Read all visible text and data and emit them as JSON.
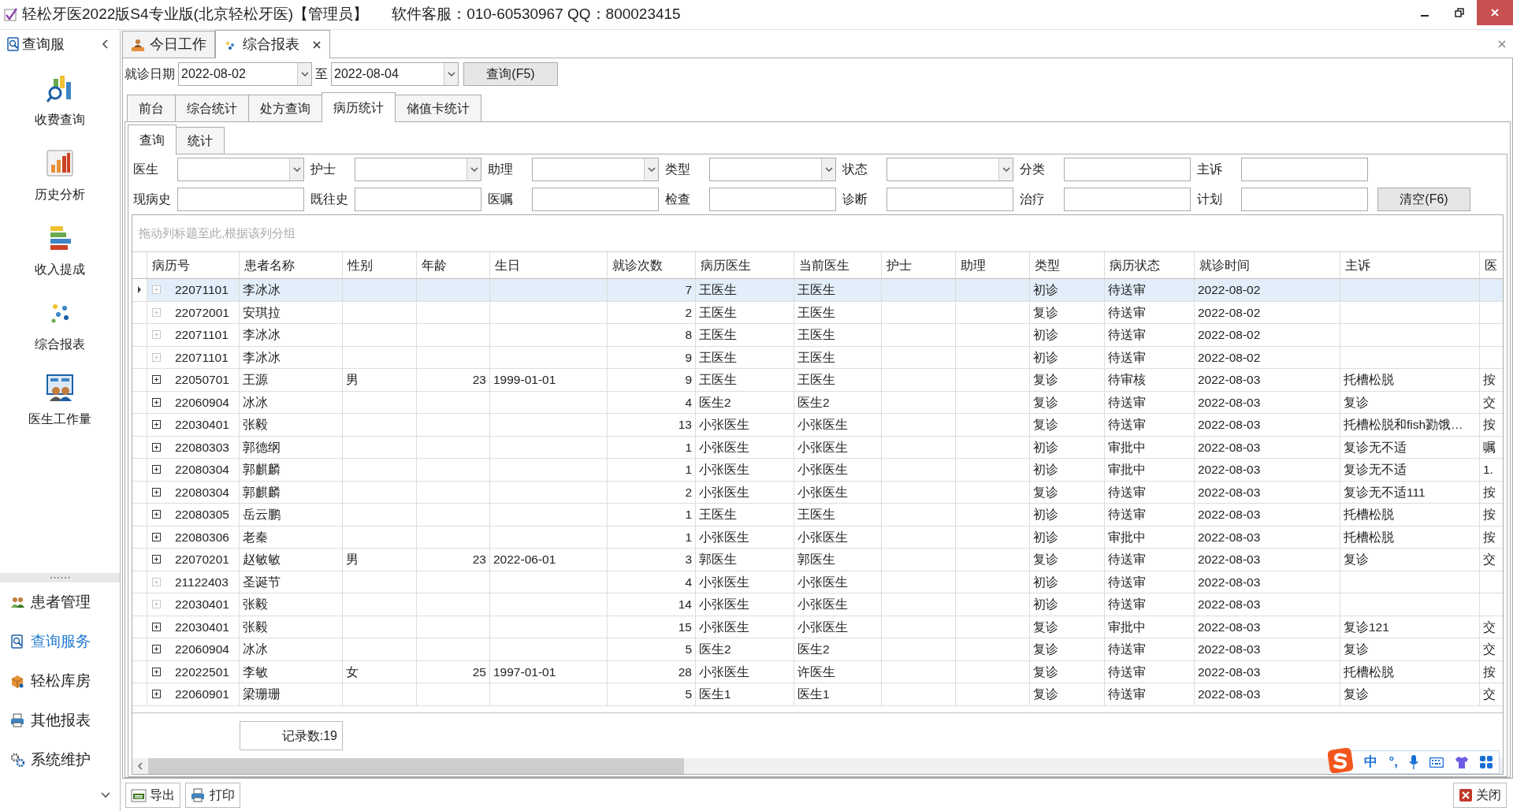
{
  "window": {
    "title": "轻松牙医2022版S4专业版(北京轻松牙医)【管理员】",
    "support": "软件客服：010-60530967 QQ：800023415"
  },
  "sidebar": {
    "header": "查询服",
    "items": [
      {
        "label": "收费查询",
        "kind": "search-chart"
      },
      {
        "label": "历史分析",
        "kind": "bar-chart"
      },
      {
        "label": "收入提成",
        "kind": "stacked"
      },
      {
        "label": "综合报表",
        "kind": "dots"
      },
      {
        "label": "医生工作量",
        "kind": "board"
      }
    ],
    "nav": [
      {
        "label": "患者管理",
        "kind": "people",
        "selected": false
      },
      {
        "label": "查询服务",
        "kind": "search",
        "selected": true
      },
      {
        "label": "轻松库房",
        "kind": "box",
        "selected": false
      },
      {
        "label": "其他报表",
        "kind": "printer",
        "selected": false
      },
      {
        "label": "系统维护",
        "kind": "gears",
        "selected": false
      }
    ]
  },
  "doc_tabs": [
    {
      "label": "今日工作",
      "kind": "desk",
      "selected": false,
      "closable": false
    },
    {
      "label": "综合报表",
      "kind": "dots",
      "selected": true,
      "closable": true
    }
  ],
  "date_filter": {
    "label": "就诊日期",
    "from": "2022-08-02",
    "separator": "至",
    "to": "2022-08-04",
    "button": "查询(F5)"
  },
  "report_tabs": [
    {
      "label": "前台",
      "selected": false
    },
    {
      "label": "综合统计",
      "selected": false
    },
    {
      "label": "处方查询",
      "selected": false
    },
    {
      "label": "病历统计",
      "selected": true
    },
    {
      "label": "储值卡统计",
      "selected": false
    }
  ],
  "sub_tabs": [
    {
      "label": "查询",
      "selected": true
    },
    {
      "label": "统计",
      "selected": false
    }
  ],
  "filters": [
    {
      "label": "医生",
      "kind": "combo"
    },
    {
      "label": "护士",
      "kind": "combo"
    },
    {
      "label": "助理",
      "kind": "combo"
    },
    {
      "label": "类型",
      "kind": "combo"
    },
    {
      "label": "状态",
      "kind": "combo"
    },
    {
      "label": "分类",
      "kind": "text"
    },
    {
      "label": "主诉",
      "kind": "text"
    },
    {
      "label": "现病史",
      "kind": "text"
    },
    {
      "label": "既往史",
      "kind": "text"
    },
    {
      "label": "医嘱",
      "kind": "text"
    },
    {
      "label": "检查",
      "kind": "text"
    },
    {
      "label": "诊断",
      "kind": "text"
    },
    {
      "label": "治疗",
      "kind": "text"
    },
    {
      "label": "计划",
      "kind": "text"
    }
  ],
  "clear_button": "清空(F6)",
  "group_hint": "拖动列标题至此,根据该列分组",
  "table": {
    "columns": [
      "病历号",
      "患者名称",
      "性别",
      "年龄",
      "生日",
      "就诊次数",
      "病历医生",
      "当前医生",
      "护士",
      "助理",
      "类型",
      "病历状态",
      "就诊时间",
      "主诉",
      "医"
    ],
    "rows": [
      {
        "selected": true,
        "expandable": false,
        "record_no": "22071101",
        "patient": "李冰冰",
        "visits": "7",
        "record_doctor": "王医生",
        "current_doctor": "王医生",
        "type": "初诊",
        "status": "待送审",
        "visit_date": "2022-08-02"
      },
      {
        "selected": false,
        "expandable": false,
        "record_no": "22072001",
        "patient": "安琪拉",
        "visits": "2",
        "record_doctor": "王医生",
        "current_doctor": "王医生",
        "type": "复诊",
        "status": "待送审",
        "visit_date": "2022-08-02"
      },
      {
        "selected": false,
        "expandable": false,
        "record_no": "22071101",
        "patient": "李冰冰",
        "visits": "8",
        "record_doctor": "王医生",
        "current_doctor": "王医生",
        "type": "初诊",
        "status": "待送审",
        "visit_date": "2022-08-02"
      },
      {
        "selected": false,
        "expandable": false,
        "record_no": "22071101",
        "patient": "李冰冰",
        "visits": "9",
        "record_doctor": "王医生",
        "current_doctor": "王医生",
        "type": "初诊",
        "status": "待送审",
        "visit_date": "2022-08-02"
      },
      {
        "selected": false,
        "expandable": true,
        "record_no": "22050701",
        "patient": "王源",
        "sex": "男",
        "age": "23",
        "birthday": "1999-01-01",
        "visits": "9",
        "record_doctor": "王医生",
        "current_doctor": "王医生",
        "type": "复诊",
        "status": "待审核",
        "visit_date": "2022-08-03",
        "complaint": "托槽松脱",
        "column_15": "按"
      },
      {
        "selected": false,
        "expandable": true,
        "record_no": "22060904",
        "patient": "冰冰",
        "visits": "4",
        "record_doctor": "医生2",
        "current_doctor": "医生2",
        "type": "复诊",
        "status": "待送审",
        "visit_date": "2022-08-03",
        "complaint": "复诊",
        "column_15": "交"
      },
      {
        "selected": false,
        "expandable": true,
        "record_no": "22030401",
        "patient": "张毅",
        "visits": "13",
        "record_doctor": "小张医生",
        "current_doctor": "小张医生",
        "type": "复诊",
        "status": "待送审",
        "visit_date": "2022-08-03",
        "complaint": "托槽松脱和fish勠饿…",
        "column_15": "按"
      },
      {
        "selected": false,
        "expandable": true,
        "record_no": "22080303",
        "patient": "郭德纲",
        "visits": "1",
        "record_doctor": "小张医生",
        "current_doctor": "小张医生",
        "type": "初诊",
        "status": "审批中",
        "visit_date": "2022-08-03",
        "complaint": "复诊无不适",
        "column_15": "嘱"
      },
      {
        "selected": false,
        "expandable": true,
        "record_no": "22080304",
        "patient": "郭麒麟",
        "visits": "1",
        "record_doctor": "小张医生",
        "current_doctor": "小张医生",
        "type": "初诊",
        "status": "审批中",
        "visit_date": "2022-08-03",
        "complaint": "复诊无不适",
        "column_15": "1."
      },
      {
        "selected": false,
        "expandable": true,
        "record_no": "22080304",
        "patient": "郭麒麟",
        "visits": "2",
        "record_doctor": "小张医生",
        "current_doctor": "小张医生",
        "type": "复诊",
        "status": "待送审",
        "visit_date": "2022-08-03",
        "complaint": "复诊无不适111",
        "column_15": "按"
      },
      {
        "selected": false,
        "expandable": true,
        "record_no": "22080305",
        "patient": "岳云鹏",
        "visits": "1",
        "record_doctor": "王医生",
        "current_doctor": "王医生",
        "type": "初诊",
        "status": "待送审",
        "visit_date": "2022-08-03",
        "complaint": "托槽松脱",
        "column_15": "按"
      },
      {
        "selected": false,
        "expandable": true,
        "record_no": "22080306",
        "patient": "老秦",
        "visits": "1",
        "record_doctor": "小张医生",
        "current_doctor": "小张医生",
        "type": "初诊",
        "status": "审批中",
        "visit_date": "2022-08-03",
        "complaint": "托槽松脱",
        "column_15": "按"
      },
      {
        "selected": false,
        "expandable": true,
        "record_no": "22070201",
        "patient": "赵敏敏",
        "sex": "男",
        "age": "23",
        "birthday": "2022-06-01",
        "visits": "3",
        "record_doctor": "郭医生",
        "current_doctor": "郭医生",
        "type": "复诊",
        "status": "待送审",
        "visit_date": "2022-08-03",
        "complaint": "复诊",
        "column_15": "交"
      },
      {
        "selected": false,
        "expandable": false,
        "record_no": "21122403",
        "patient": "圣诞节",
        "visits": "4",
        "record_doctor": "小张医生",
        "current_doctor": "小张医生",
        "type": "初诊",
        "status": "待送审",
        "visit_date": "2022-08-03"
      },
      {
        "selected": false,
        "expandable": false,
        "record_no": "22030401",
        "patient": "张毅",
        "visits": "14",
        "record_doctor": "小张医生",
        "current_doctor": "小张医生",
        "type": "初诊",
        "status": "待送审",
        "visit_date": "2022-08-03"
      },
      {
        "selected": false,
        "expandable": true,
        "record_no": "22030401",
        "patient": "张毅",
        "visits": "15",
        "record_doctor": "小张医生",
        "current_doctor": "小张医生",
        "type": "复诊",
        "status": "审批中",
        "visit_date": "2022-08-03",
        "complaint": "复诊121",
        "column_15": "交"
      },
      {
        "selected": false,
        "expandable": true,
        "record_no": "22060904",
        "patient": "冰冰",
        "visits": "5",
        "record_doctor": "医生2",
        "current_doctor": "医生2",
        "type": "复诊",
        "status": "待送审",
        "visit_date": "2022-08-03",
        "complaint": "复诊",
        "column_15": "交"
      },
      {
        "selected": false,
        "expandable": true,
        "record_no": "22022501",
        "patient": "李敏",
        "sex": "女",
        "age": "25",
        "birthday": "1997-01-01",
        "visits": "28",
        "record_doctor": "小张医生",
        "current_doctor": "许医生",
        "type": "复诊",
        "status": "待送审",
        "visit_date": "2022-08-03",
        "complaint": "托槽松脱",
        "column_15": "按"
      },
      {
        "selected": false,
        "expandable": true,
        "record_no": "22060901",
        "patient": "梁珊珊",
        "visits": "5",
        "record_doctor": "医生1",
        "current_doctor": "医生1",
        "type": "复诊",
        "status": "待送审",
        "visit_date": "2022-08-03",
        "complaint": "复诊",
        "column_15": "交"
      }
    ]
  },
  "record_count": "记录数:19",
  "toolbar": [
    {
      "label": "导出",
      "kind": "excel"
    },
    {
      "label": "打印",
      "kind": "printer"
    }
  ],
  "close_button": "关闭",
  "ime": {
    "mode": "中",
    "punctuation": "°,"
  }
}
